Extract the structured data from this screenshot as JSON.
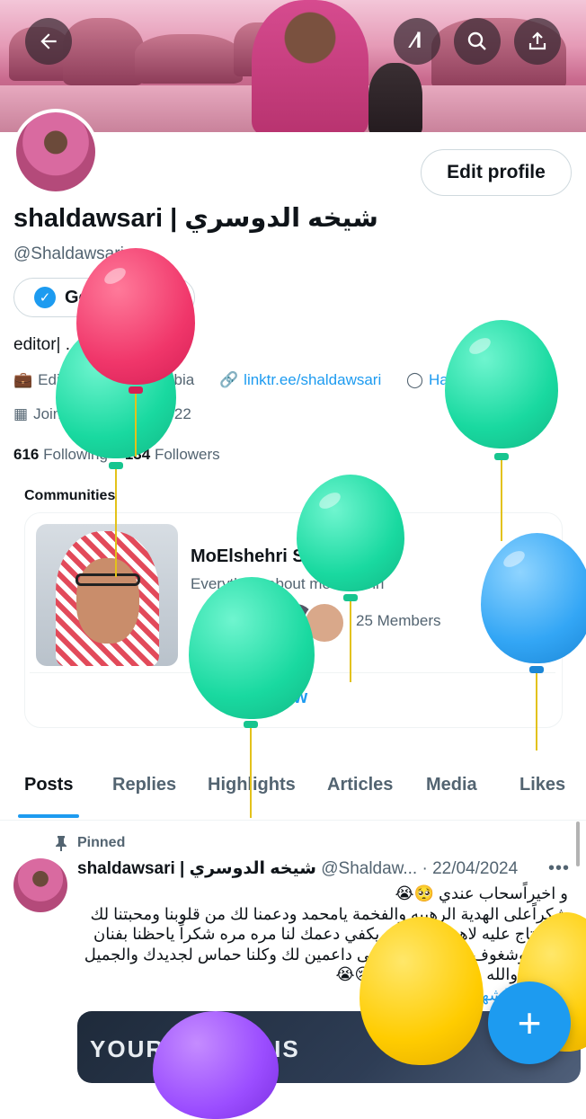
{
  "header": {
    "back_icon": "arrow-left-icon",
    "grok_icon": "grok-icon",
    "search_icon": "search-icon",
    "share_icon": "share-icon"
  },
  "profile": {
    "edit_label": "Edit profile",
    "display_name": "shaldawsari | شيخه الدوسري",
    "handle": "@Shaldawsari",
    "verified_label": "Get verified",
    "bio": "editor| ... | ـلـ",
    "occupation": "Editor",
    "location": "saudi arabia",
    "link": "linktr.ee/shaldawsari",
    "birthday": "Happy birthday!",
    "joined": "Joined November 2022",
    "following_count": "616",
    "following_label": "Following",
    "followers_count": "134",
    "followers_label": "Followers"
  },
  "communities": {
    "title": "Communities",
    "name": "MoElshehri Squad",
    "description": "Everything about moelshehri",
    "members": "25 Members",
    "view_label": "View"
  },
  "tabs": [
    "Posts",
    "Replies",
    "Highlights",
    "Articles",
    "Media",
    "Likes"
  ],
  "active_tab": "Posts",
  "post": {
    "pinned_label": "Pinned",
    "author": "shaldawsari | شيخه الدوسري",
    "handle_date": "@Shaldaw... · 22/04/2024",
    "line1": "و اخيراًسحاب عندي 🥺😭",
    "line2": "شكراًعلى الهدية الرهيبه والفخمة يامحمد ودعمنا لك من قلوبنا ومحبتنا لك ما نحتاج عليه لاهدايا ولاشكر يكفي دعمك لنا مره مره شكراً ياحظنا بفنان رهيب وشغوف مثلك وتأكد بنبقى داعمين لك وكلنا حماس لجديدك والجميل كعادتك والله يضيع مني الكلام 😢😭",
    "hashtag": "#محمد_الشهري",
    "media_text": "YOUR NEW ... IS"
  },
  "compose": {
    "icon": "plus-icon"
  },
  "colors": {
    "accent": "#1d9bf0",
    "text": "#0f1419",
    "muted": "#536471"
  }
}
